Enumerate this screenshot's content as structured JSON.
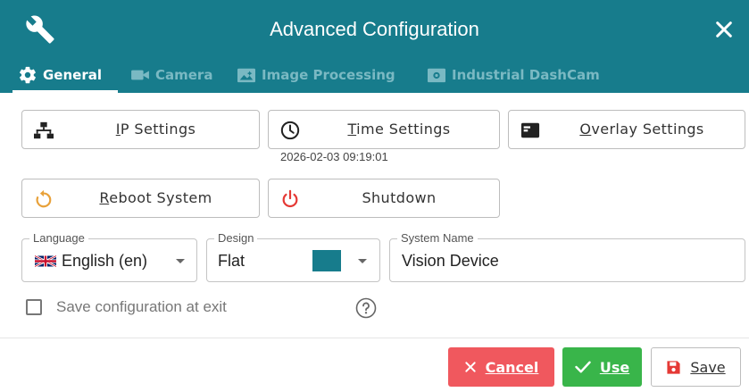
{
  "window": {
    "title": "Advanced Configuration",
    "accent_color": "#177c8c",
    "icons": {
      "app": "wrench-icon",
      "close": "close-icon"
    }
  },
  "tabs": [
    {
      "label": "General",
      "icon": "gear-icon",
      "active": true
    },
    {
      "label": "Camera",
      "icon": "video-camera-icon",
      "active": false
    },
    {
      "label": "Image Processing",
      "icon": "image-processing-icon",
      "active": false
    },
    {
      "label": "Industrial DashCam",
      "icon": "dashcam-icon",
      "active": false
    }
  ],
  "buttons": {
    "ip_settings": {
      "hotkey": "I",
      "rest": "P Settings",
      "icon": "network-icon"
    },
    "time_settings": {
      "hotkey": "T",
      "rest": "ime Settings",
      "icon": "clock-icon"
    },
    "overlay_settings": {
      "hotkey": "O",
      "rest": "verlay Settings",
      "icon": "overlay-icon"
    },
    "reboot_system": {
      "hotkey": "R",
      "rest": "eboot System",
      "icon": "reboot-icon",
      "icon_color": "#e8a13a"
    },
    "shutdown": {
      "label": "Shutdown",
      "icon": "power-icon",
      "icon_color": "#e53935"
    }
  },
  "time_value": "2026-02-03 09:19:01",
  "fields": {
    "language": {
      "legend": "Language",
      "value": "English (en)",
      "flag": "uk-flag-icon"
    },
    "design": {
      "legend": "Design",
      "value": "Flat",
      "swatch_color": "#177c8c"
    },
    "system_name": {
      "legend": "System Name",
      "value": "Vision Device"
    }
  },
  "save_on_exit": {
    "label": "Save configuration at exit",
    "checked": false
  },
  "footer": {
    "cancel": {
      "hotkey": "C",
      "rest": "ancel",
      "color": "#f0585e",
      "icon": "x-icon"
    },
    "use": {
      "hotkey": "U",
      "rest": "se",
      "color": "#39b54a",
      "icon": "check-icon"
    },
    "save": {
      "hotkey": "S",
      "rest": "ave",
      "icon": "floppy-disk-icon",
      "icon_color": "#e53935"
    }
  }
}
